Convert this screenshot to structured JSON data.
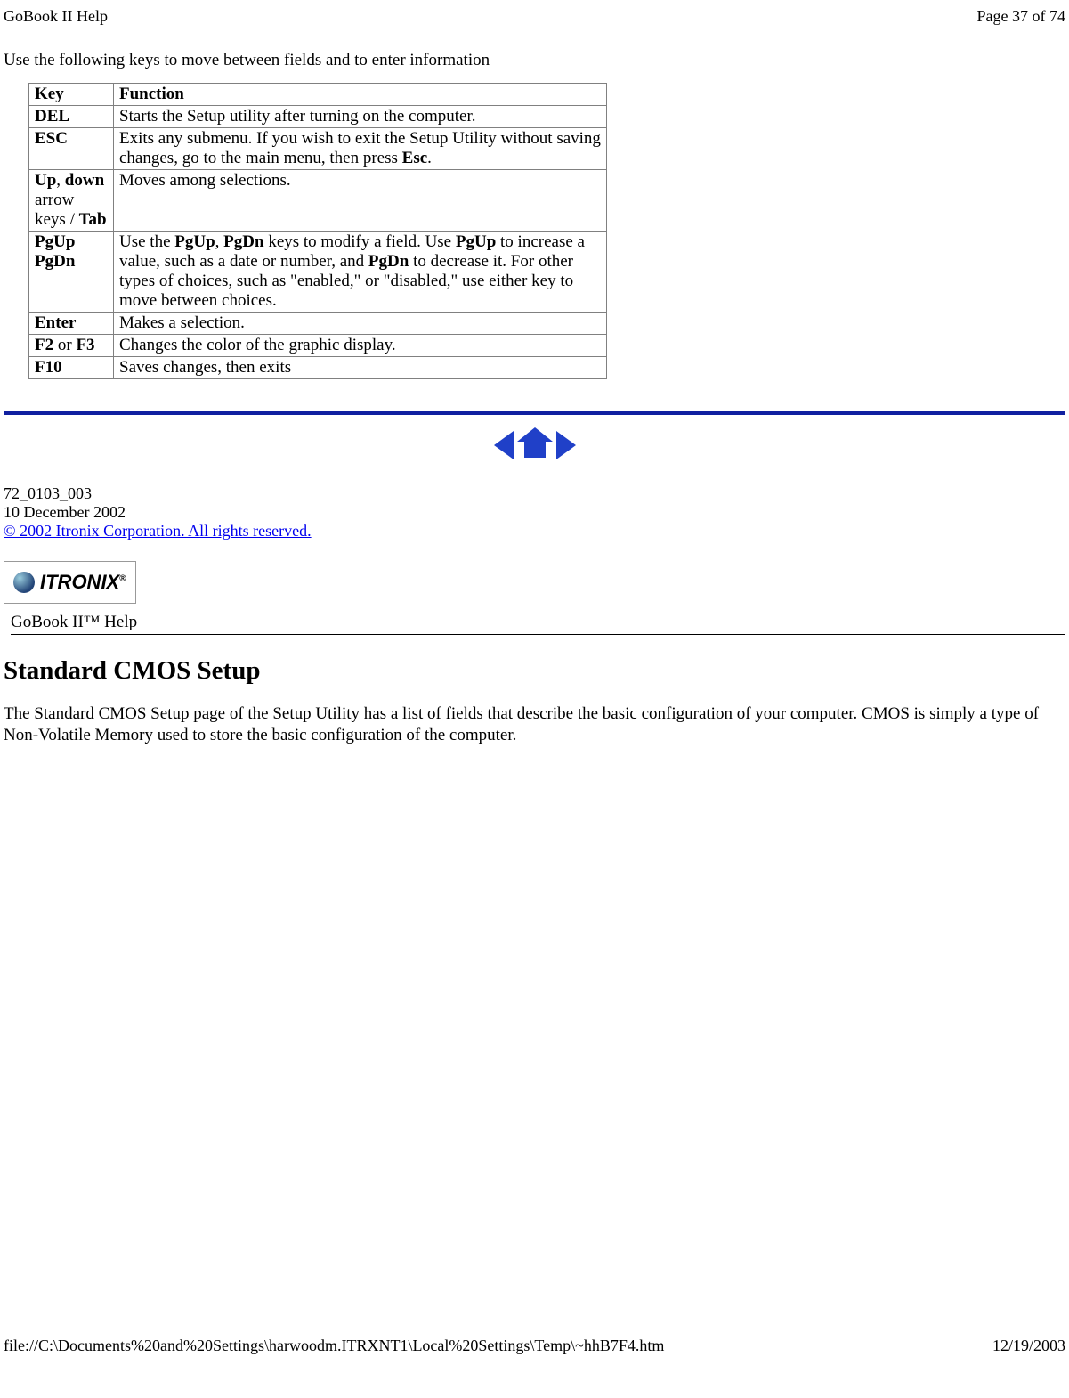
{
  "header": {
    "title": "GoBook II Help",
    "pagination": "Page 37 of 74"
  },
  "intro": "Use the following keys to move between fields and to enter information",
  "table": {
    "head": {
      "key": "Key",
      "func": "Function"
    },
    "rows": [
      {
        "key_html": "<span class='bold'>DEL</span>",
        "func_html": "Starts the Setup utility after turning on the computer."
      },
      {
        "key_html": "<span class='bold'>ESC</span>",
        "func_html": "Exits any submenu.  If you wish to exit the Setup Utility without saving changes, go to the main menu, then press <span class='bold'>Esc</span>."
      },
      {
        "key_html": "<span class='bold'>Up</span>, <span class='bold'>down</span> arrow keys / <span class='bold'>Tab</span>",
        "func_html": "Moves among selections."
      },
      {
        "key_html": "<span class='bold'>PgUp PgDn</span>",
        "func_html": "Use the <span class='bold'>PgUp</span>, <span class='bold'>PgDn</span> keys to modify a field.  Use <span class='bold'>PgUp</span> to increase a value, such as a date or number, and <span class='bold'>PgDn</span> to decrease it.  For other types of choices, such as \"enabled,\" or \"disabled,\" use either key to move between choices."
      },
      {
        "key_html": "<span class='bold'>Enter</span>",
        "func_html": "Makes a selection."
      },
      {
        "key_html": "<span class='bold'>F2</span> or <span class='bold'>F3</span>",
        "func_html": "Changes the color of the graphic display."
      },
      {
        "key_html": "<span class='bold'>F10</span>",
        "func_html": "Saves changes, then exits"
      }
    ]
  },
  "docinfo": {
    "num": "72_0103_003",
    "date": "10 December 2002",
    "copyright": "© 2002 Itronix Corporation.  All rights reserved."
  },
  "logo": {
    "brand": "ITRONIX",
    "sup": "®"
  },
  "help_label": "GoBook II™ Help",
  "section": {
    "title": "Standard CMOS Setup",
    "body": "The Standard CMOS Setup page of the Setup Utility has a list of fields that describe the basic configuration of your computer.  CMOS is simply a type of Non-Volatile Memory used to store the basic configuration of the computer."
  },
  "footer": {
    "path": "file://C:\\Documents%20and%20Settings\\harwoodm.ITRXNT1\\Local%20Settings\\Temp\\~hhB7F4.htm",
    "date": "12/19/2003"
  }
}
